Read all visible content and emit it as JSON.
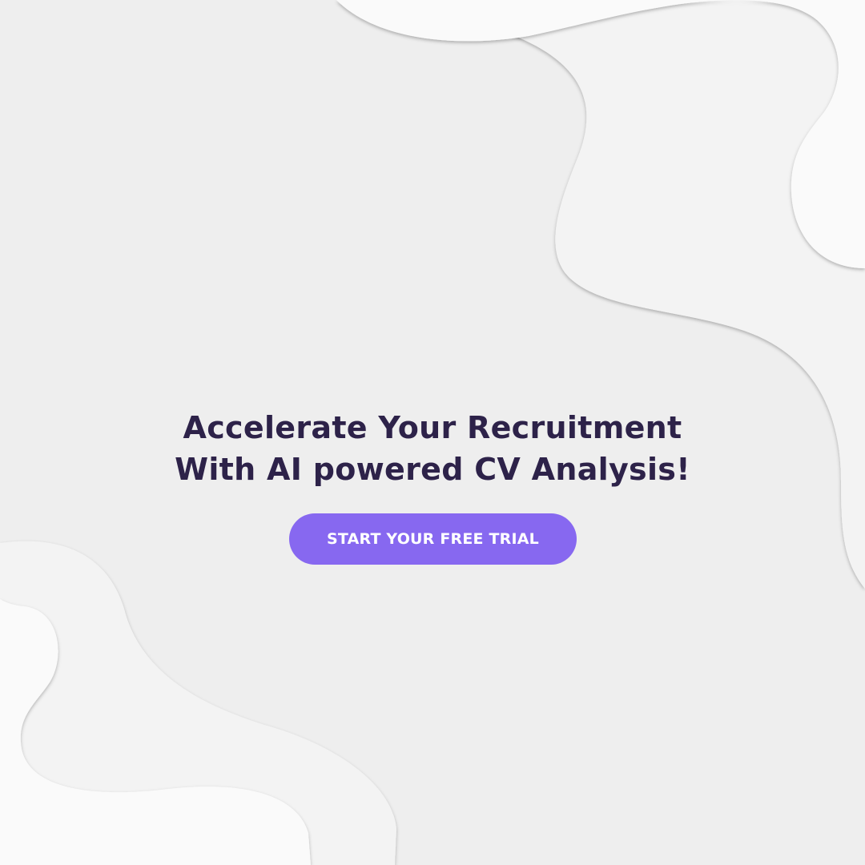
{
  "headline": {
    "line1": "Accelerate Your Recruitment",
    "line2": "With AI powered CV Analysis!"
  },
  "cta": {
    "label": "START YOUR FREE TRIAL"
  },
  "colors": {
    "background": "#eeeeee",
    "blob_light": "#f3f3f3",
    "blob_lightest": "#fafafa",
    "headline_text": "#2d2249",
    "cta_background": "#8768f0",
    "cta_text": "#ffffff"
  }
}
